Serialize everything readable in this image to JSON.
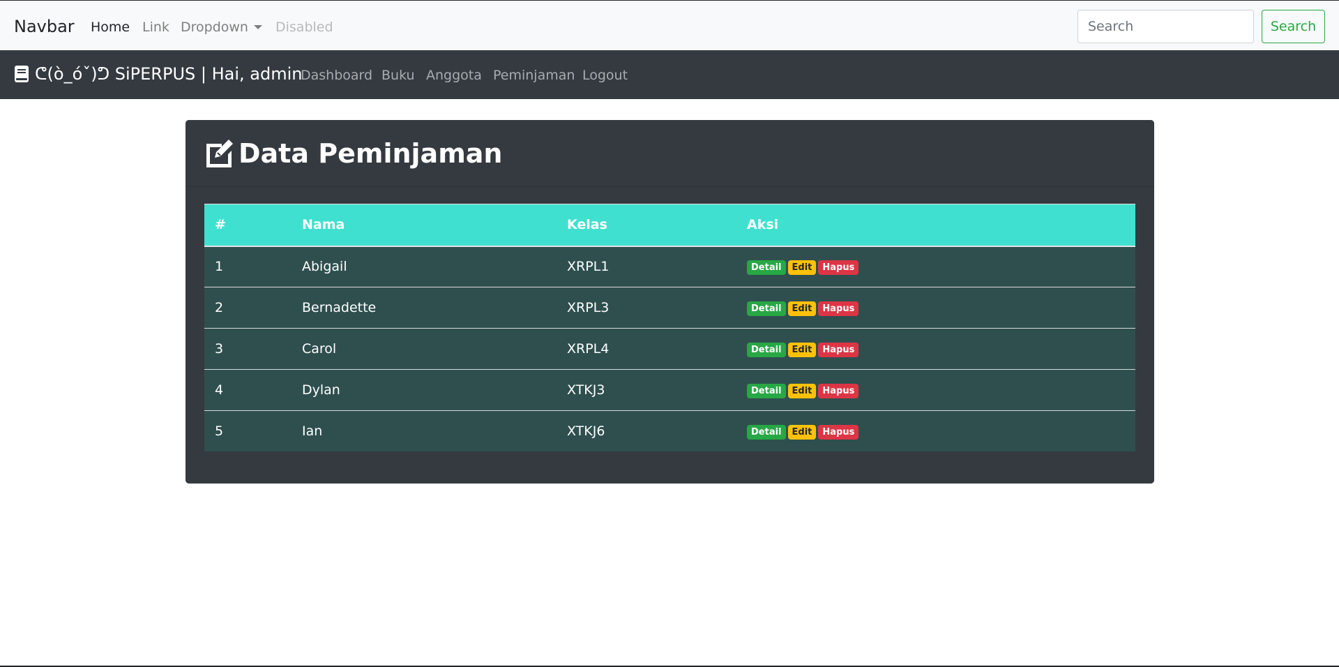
{
  "top_nav": {
    "brand": "Navbar",
    "items": [
      {
        "label": "Home"
      },
      {
        "label": "Link"
      },
      {
        "label": "Dropdown"
      },
      {
        "label": "Disabled"
      }
    ],
    "search_placeholder": "Search",
    "search_button": "Search"
  },
  "app_nav": {
    "brand": "ᕦ(ò_óˇ)ᕤ SiPERPUS | Hai, admin",
    "items": [
      {
        "label": "Dashboard"
      },
      {
        "label": "Buku"
      },
      {
        "label": "Anggota"
      },
      {
        "label": "Peminjaman"
      },
      {
        "label": "Logout"
      }
    ]
  },
  "card": {
    "title": "Data Peminjaman"
  },
  "table": {
    "headers": [
      "#",
      "Nama",
      "Kelas",
      "Aksi"
    ],
    "rows": [
      {
        "no": "1",
        "nama": "Abigail",
        "kelas": "XRPL1"
      },
      {
        "no": "2",
        "nama": "Bernadette",
        "kelas": "XRPL3"
      },
      {
        "no": "3",
        "nama": "Carol",
        "kelas": "XRPL4"
      },
      {
        "no": "4",
        "nama": "Dylan",
        "kelas": "XTKJ3"
      },
      {
        "no": "5",
        "nama": "Ian",
        "kelas": "XTKJ6"
      }
    ],
    "actions": {
      "detail": "Detail",
      "edit": "Edit",
      "hapus": "Hapus"
    }
  },
  "colors": {
    "header_teal": "#40e0d0",
    "row_bg": "#2f4f4f",
    "card_bg": "#343a40",
    "success": "#28a745",
    "warning": "#ffc107",
    "danger": "#dc3545"
  },
  "icons": {
    "brand_icon": "book-icon",
    "title_icon": "edit-icon"
  }
}
